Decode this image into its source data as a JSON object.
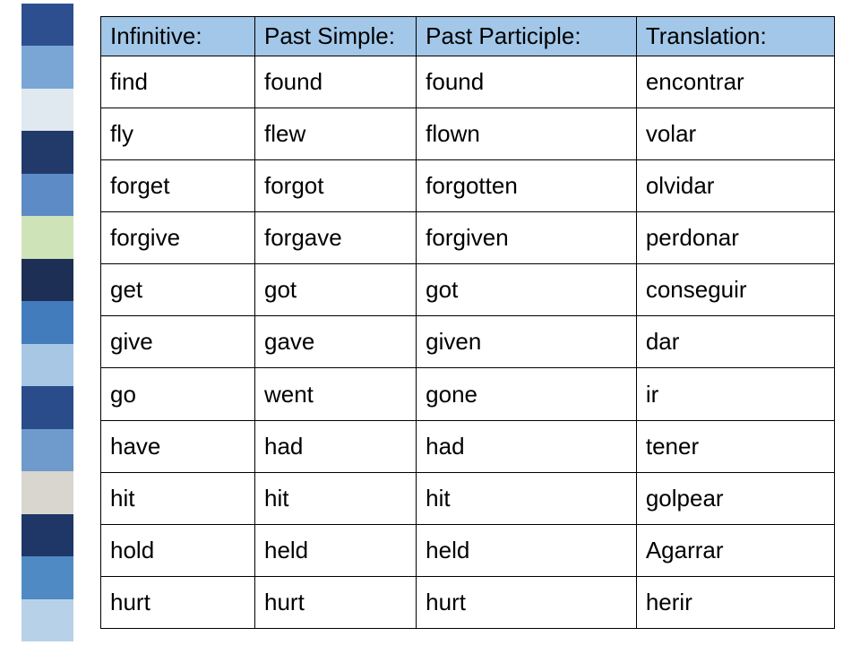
{
  "stripes": [
    "#2d4f8f",
    "#7aa6d6",
    "#dfe9ef",
    "#223a6a",
    "#5c8bc6",
    "#cfe3b9",
    "#1d2f55",
    "#437cbd",
    "#a8c7e4",
    "#2a4c8a",
    "#6e9acc",
    "#d9d6cf",
    "#1e3766",
    "#508ac5",
    "#b7d2e8"
  ],
  "headers": {
    "infinitive": "Infinitive:",
    "past_simple": "Past Simple:",
    "past_participle": "Past Participle:",
    "translation": "Translation:"
  },
  "rows": [
    {
      "infinitive": "find",
      "past_simple": "found",
      "past_participle": "found",
      "translation": "encontrar"
    },
    {
      "infinitive": "fly",
      "past_simple": "flew",
      "past_participle": "flown",
      "translation": "volar"
    },
    {
      "infinitive": "forget",
      "past_simple": "forgot",
      "past_participle": "forgotten",
      "translation": "olvidar"
    },
    {
      "infinitive": "forgive",
      "past_simple": "forgave",
      "past_participle": "forgiven",
      "translation": "perdonar"
    },
    {
      "infinitive": "get",
      "past_simple": "got",
      "past_participle": "got",
      "translation": "conseguir"
    },
    {
      "infinitive": "give",
      "past_simple": "gave",
      "past_participle": "given",
      "translation": "dar"
    },
    {
      "infinitive": "go",
      "past_simple": "went",
      "past_participle": "gone",
      "translation": "ir"
    },
    {
      "infinitive": "have",
      "past_simple": "had",
      "past_participle": "had",
      "translation": "tener"
    },
    {
      "infinitive": "hit",
      "past_simple": "hit",
      "past_participle": "hit",
      "translation": "golpear"
    },
    {
      "infinitive": "hold",
      "past_simple": "held",
      "past_participle": "held",
      "translation": "Agarrar"
    },
    {
      "infinitive": "hurt",
      "past_simple": "hurt",
      "past_participle": "hurt",
      "translation": "herir"
    }
  ],
  "chart_data": {
    "type": "table",
    "columns": [
      "Infinitive:",
      "Past Simple:",
      "Past Participle:",
      "Translation:"
    ],
    "data": [
      [
        "find",
        "found",
        "found",
        "encontrar"
      ],
      [
        "fly",
        "flew",
        "flown",
        "volar"
      ],
      [
        "forget",
        "forgot",
        "forgotten",
        "olvidar"
      ],
      [
        "forgive",
        "forgave",
        "forgiven",
        "perdonar"
      ],
      [
        "get",
        "got",
        "got",
        "conseguir"
      ],
      [
        "give",
        "gave",
        "given",
        "dar"
      ],
      [
        "go",
        "went",
        "gone",
        "ir"
      ],
      [
        "have",
        "had",
        "had",
        "tener"
      ],
      [
        "hit",
        "hit",
        "hit",
        "golpear"
      ],
      [
        "hold",
        "held",
        "held",
        "Agarrar"
      ],
      [
        "hurt",
        "hurt",
        "hurt",
        "herir"
      ]
    ]
  }
}
